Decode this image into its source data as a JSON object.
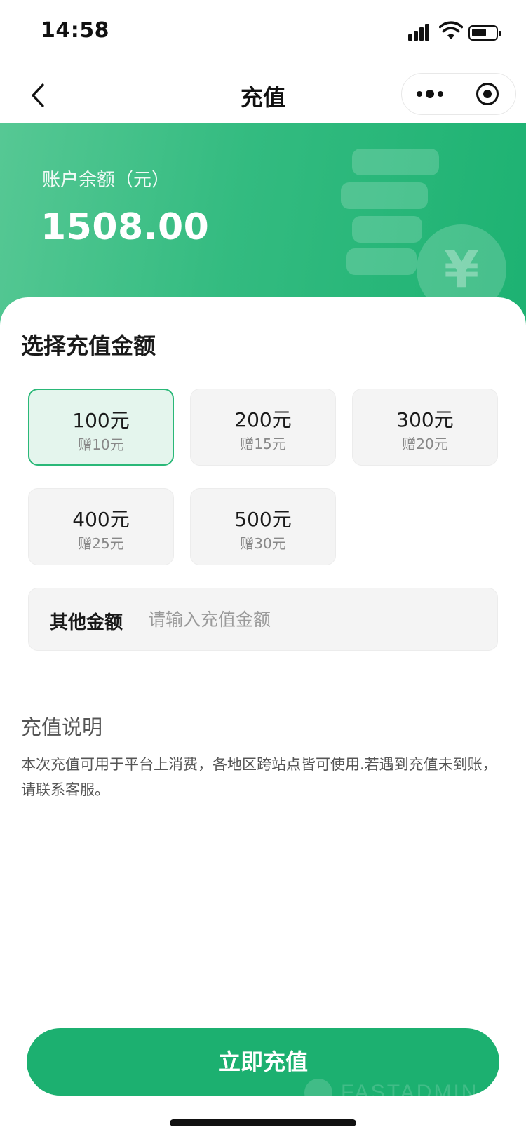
{
  "status_bar": {
    "time": "14:58",
    "icons": [
      "cellular-signal-icon",
      "wifi-icon",
      "battery-icon"
    ]
  },
  "nav": {
    "title": "充值",
    "back_icon": "chevron-left-icon",
    "more_icon": "more-dots-icon",
    "close_icon": "target-circle-icon"
  },
  "hero": {
    "balance_label": "账户余额（元）",
    "balance_value": "1508.00",
    "illustration_glyph": "¥",
    "gradient_start": "#56c894",
    "gradient_end": "#1db272"
  },
  "recharge": {
    "section_title": "选择充值金额",
    "options": [
      {
        "amount": "100元",
        "bonus": "赠10元",
        "selected": true
      },
      {
        "amount": "200元",
        "bonus": "赠15元",
        "selected": false
      },
      {
        "amount": "300元",
        "bonus": "赠20元",
        "selected": false
      },
      {
        "amount": "400元",
        "bonus": "赠25元",
        "selected": false
      },
      {
        "amount": "500元",
        "bonus": "赠30元",
        "selected": false
      }
    ],
    "custom": {
      "label": "其他金额",
      "placeholder": "请输入充值金额",
      "value": ""
    }
  },
  "notes": {
    "title": "充值说明",
    "body": "本次充值可用于平台上消费，各地区跨站点皆可使用.若遇到充值未到账，请联系客服。"
  },
  "submit": {
    "label": "立即充值",
    "color": "#1cb070"
  },
  "watermark": {
    "text": "FASTADMIN"
  },
  "colors": {
    "accent": "#1cb070",
    "selected_border": "#2ab878",
    "selected_bg": "#e4f5ed"
  }
}
